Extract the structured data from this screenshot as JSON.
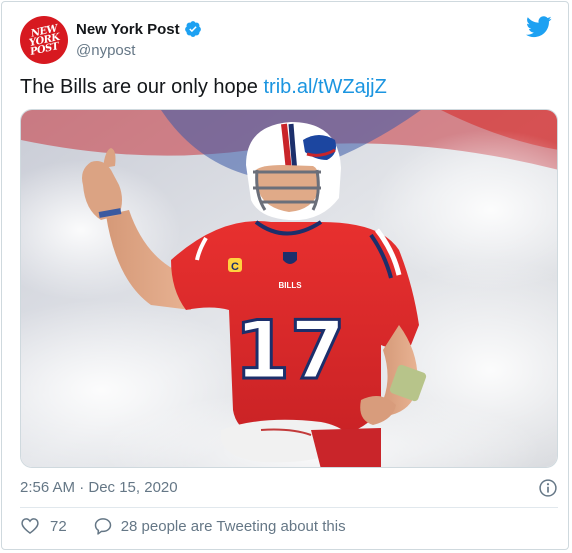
{
  "colors": {
    "link": "#1b95e0",
    "brand_red": "#d71920",
    "twitter_blue": "#1da1f2",
    "secondary_text": "#657786",
    "jersey_red": "#d92a2e"
  },
  "author": {
    "avatar_text": [
      "NEW",
      "YORK",
      "POST"
    ],
    "name": "New York Post",
    "handle": "@nypost",
    "verified_icon": "verified-badge-icon"
  },
  "tweet": {
    "text": "The Bills are our only hope",
    "link": "trib.al/tWZajjZ"
  },
  "media": {
    "jersey_number": "17",
    "chest_text": "BILLS",
    "captain_patch": "C"
  },
  "meta": {
    "timestamp": "2:56 AM · Dec 15, 2020"
  },
  "actions": {
    "like_count": "72",
    "reply_text": "28 people are Tweeting about this"
  }
}
